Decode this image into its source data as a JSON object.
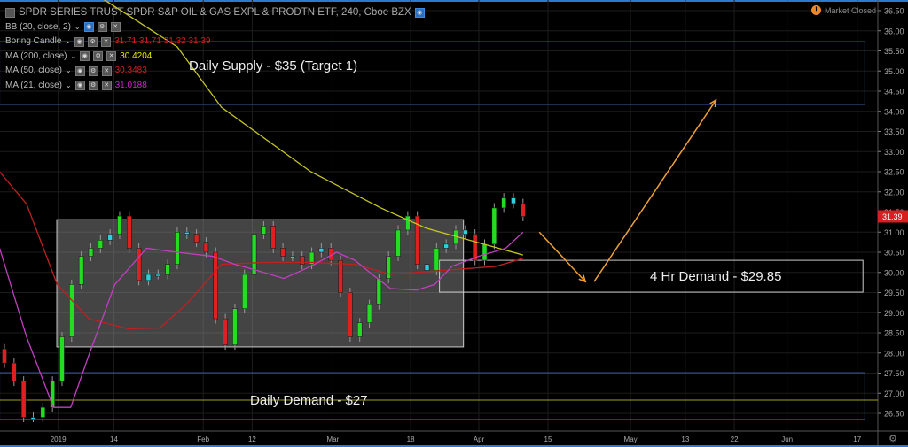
{
  "header": {
    "symbol_title": "SPDR SERIES TRUST SPDR S&P OIL & GAS EXPL & PRODTN ETF, 240, Cboe BZX",
    "market_status": "Market Closed"
  },
  "indicators": [
    {
      "name": "BB (20, close, 2)",
      "value": "",
      "color": "#777777"
    },
    {
      "name": "Boring Candle",
      "value": "31.71  31.71  31.32  31.39",
      "color": "#d02020"
    },
    {
      "name": "MA (200, close)",
      "value": "30.4204",
      "color": "#e8e800"
    },
    {
      "name": "MA (50, close)",
      "value": "30.3483",
      "color": "#d02020"
    },
    {
      "name": "MA (21, close)",
      "value": "31.0188",
      "color": "#d020d0"
    }
  ],
  "annotations": {
    "supply": "Daily Supply - $35 (Target 1)",
    "demand_4hr": "4 Hr Demand - $29.85",
    "demand_daily": "Daily Demand - $27"
  },
  "chart_data": {
    "type": "candlestick",
    "title": "SPDR SERIES TRUST SPDR S&P OIL & GAS EXPL & PRODTN ETF, 240, Cboe BZX",
    "ylim": [
      26.2,
      36.7
    ],
    "xlim": [
      -0.5,
      91
    ],
    "y_ticks": [
      "36.50",
      "36.00",
      "35.50",
      "35.00",
      "34.50",
      "34.00",
      "33.50",
      "33.00",
      "32.50",
      "32.00",
      "31.50",
      "31.00",
      "30.50",
      "30.00",
      "29.50",
      "29.00",
      "28.50",
      "28.00",
      "27.50",
      "27.00",
      "26.50"
    ],
    "x_ticks": [
      {
        "label": "2019",
        "bar": 5.6
      },
      {
        "label": "14",
        "bar": 11.4
      },
      {
        "label": "Feb",
        "bar": 20.7
      },
      {
        "label": "12",
        "bar": 25.8
      },
      {
        "label": "Mar",
        "bar": 34.2
      },
      {
        "label": "18",
        "bar": 42.3
      },
      {
        "label": "Apr",
        "bar": 49.4
      },
      {
        "label": "15",
        "bar": 56.6
      },
      {
        "label": "May",
        "bar": 65.2
      },
      {
        "label": "13",
        "bar": 70.9
      },
      {
        "label": "22",
        "bar": 76
      },
      {
        "label": "Jun",
        "bar": 81.5
      },
      {
        "label": "17",
        "bar": 88.8
      }
    ],
    "closes": [
      27.75,
      27.3,
      26.4,
      26.4,
      26.65,
      27.3,
      28.4,
      29.7,
      30.4,
      30.6,
      30.8,
      30.95,
      31.4,
      30.6,
      29.8,
      29.95,
      29.95,
      30.2,
      31.0,
      30.95,
      30.75,
      30.5,
      28.85,
      28.2,
      29.1,
      29.95,
      30.95,
      31.15,
      30.6,
      30.4,
      30.4,
      30.2,
      30.5,
      30.6,
      30.3,
      29.5,
      28.4,
      28.75,
      29.2,
      29.85,
      30.4,
      31.05,
      31.4,
      30.2,
      30.05,
      30.6,
      30.7,
      31.05,
      30.95,
      30.3,
      30.7,
      31.6,
      31.85,
      31.71,
      31.39
    ],
    "first_open": 28.1,
    "last_price": "31.39",
    "moving_averages": [
      {
        "name": "MA 200",
        "color": "#c8c820",
        "points": [
          [
            10.2,
            36.8
          ],
          [
            18,
            35.6
          ],
          [
            22.6,
            34.1
          ],
          [
            31.9,
            32.5
          ],
          [
            39.2,
            31.6
          ],
          [
            43.9,
            31.1
          ],
          [
            54,
            30.43
          ]
        ]
      },
      {
        "name": "MA 50",
        "color": "#c02020",
        "points": [
          [
            -0.5,
            32.5
          ],
          [
            2.3,
            31.7
          ],
          [
            5.5,
            29.7
          ],
          [
            8.8,
            28.85
          ],
          [
            12.9,
            28.6
          ],
          [
            16.2,
            28.62
          ],
          [
            18.9,
            29.2
          ],
          [
            22.6,
            30.2
          ],
          [
            27.2,
            30.25
          ],
          [
            31.9,
            30.25
          ],
          [
            36.5,
            30.2
          ],
          [
            40.2,
            29.95
          ],
          [
            45.7,
            30.05
          ],
          [
            51.2,
            30.15
          ],
          [
            54,
            30.35
          ]
        ]
      },
      {
        "name": "MA 21",
        "color": "#c040c0",
        "points": [
          [
            -0.5,
            30.6
          ],
          [
            2.3,
            28.4
          ],
          [
            5.1,
            26.65
          ],
          [
            6.9,
            26.65
          ],
          [
            8.8,
            27.95
          ],
          [
            11.5,
            29.7
          ],
          [
            14.8,
            30.6
          ],
          [
            18,
            30.5
          ],
          [
            21.7,
            30.4
          ],
          [
            24,
            30.2
          ],
          [
            26.3,
            30.05
          ],
          [
            29.1,
            29.85
          ],
          [
            31.9,
            30.15
          ],
          [
            34.6,
            30.5
          ],
          [
            36.5,
            30.3
          ],
          [
            38.3,
            29.95
          ],
          [
            40.2,
            29.6
          ],
          [
            42.9,
            29.56
          ],
          [
            44.8,
            29.7
          ],
          [
            46.6,
            30.15
          ],
          [
            49.4,
            30.4
          ],
          [
            52.2,
            30.6
          ],
          [
            54,
            31.0
          ]
        ]
      }
    ],
    "zones": [
      {
        "name": "daily-supply",
        "bars": [
          -0.5,
          89.6
        ],
        "prices": [
          34.17,
          35.73
        ],
        "stroke": "#3a5a9a",
        "fill": "none"
      },
      {
        "name": "consolidation-box",
        "bars": [
          5.45,
          47.8
        ],
        "prices": [
          28.15,
          31.31
        ],
        "stroke": "#cccccc",
        "fill": "rgba(150,150,150,0.45)"
      },
      {
        "name": "4hr-demand",
        "bars": [
          45.3,
          89.4
        ],
        "prices": [
          29.51,
          30.3
        ],
        "stroke": "#cccccc",
        "fill": "none"
      },
      {
        "name": "daily-demand",
        "bars": [
          -0.5,
          89.6
        ],
        "prices": [
          26.35,
          27.51
        ],
        "stroke": "#3a5a9a",
        "fill": "none"
      }
    ],
    "hlines": [
      {
        "name": "yellow-level",
        "price": 26.83,
        "color": "#a0a020"
      }
    ],
    "arrows": [
      {
        "name": "pullback-arrow",
        "from": [
          55.7,
          31.0
        ],
        "to": [
          60.5,
          29.77
        ],
        "color": "#f0a030"
      },
      {
        "name": "target-arrow",
        "from": [
          61.4,
          29.77
        ],
        "to": [
          74.1,
          34.28
        ],
        "color": "#f0a030"
      }
    ]
  }
}
